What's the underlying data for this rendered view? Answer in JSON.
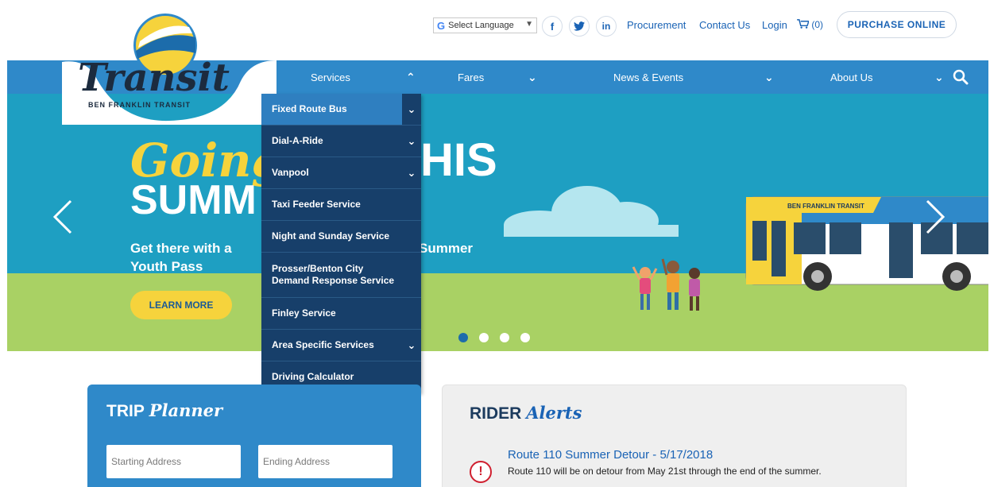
{
  "utility": {
    "language_label": "Select Language",
    "language_g": "G",
    "social": {
      "facebook": "f",
      "twitter": "t",
      "linkedin": "in"
    },
    "links": [
      "Procurement",
      "Contact Us",
      "Login"
    ],
    "cart_count": "(0)",
    "purchase_label": "PURCHASE ONLINE"
  },
  "logo": {
    "script": "Transit",
    "name": "BEN FRANKLIN TRANSIT"
  },
  "nav": {
    "items": [
      "Services",
      "Fares",
      "News & Events",
      "About Us"
    ]
  },
  "dropdown": {
    "items": [
      {
        "label": "Fixed Route Bus",
        "chevron": true,
        "active": true
      },
      {
        "label": "Dial-A-Ride",
        "chevron": true
      },
      {
        "label": "Vanpool",
        "chevron": true
      },
      {
        "label": "Taxi Feeder Service",
        "chevron": false
      },
      {
        "label": "Night and Sunday Service",
        "chevron": false
      },
      {
        "label": "Prosser/Benton City Demand Response Service",
        "chevron": false
      },
      {
        "label": "Finley Service",
        "chevron": false
      },
      {
        "label": "Area Specific Services",
        "chevron": true
      },
      {
        "label": "Driving Calculator",
        "chevron": false
      }
    ]
  },
  "hero": {
    "line1_script": "Going",
    "line1_end": "HIS",
    "line2": "SUMM",
    "sub_line1_start": "Get there with a",
    "sub_line1_end": "Summer",
    "sub_line2": "Youth Pass",
    "cta": "LEARN MORE",
    "bus_banner": "BEN FRANKLIN TRANSIT",
    "slide_count": 4,
    "active_slide": 1
  },
  "trip_planner": {
    "title_bold": "TRIP",
    "title_script": "Planner",
    "start_placeholder": "Starting Address",
    "end_placeholder": "Ending Address"
  },
  "rider_alerts": {
    "title_bold": "RIDER",
    "title_script": "Alerts",
    "alert_icon": "!",
    "alert_title": "Route 110 Summer Detour - 5/17/2018",
    "alert_body": "Route 110 will be on detour from May 21st through the end of the summer."
  },
  "colors": {
    "nav_blue": "#2f89c9",
    "dropdown_navy": "#173f6a",
    "hero_sky": "#1e9fc2",
    "grass": "#a9d164",
    "accent_yellow": "#f6d33c",
    "link_blue": "#1a63b5",
    "alert_red": "#d01f2f"
  }
}
